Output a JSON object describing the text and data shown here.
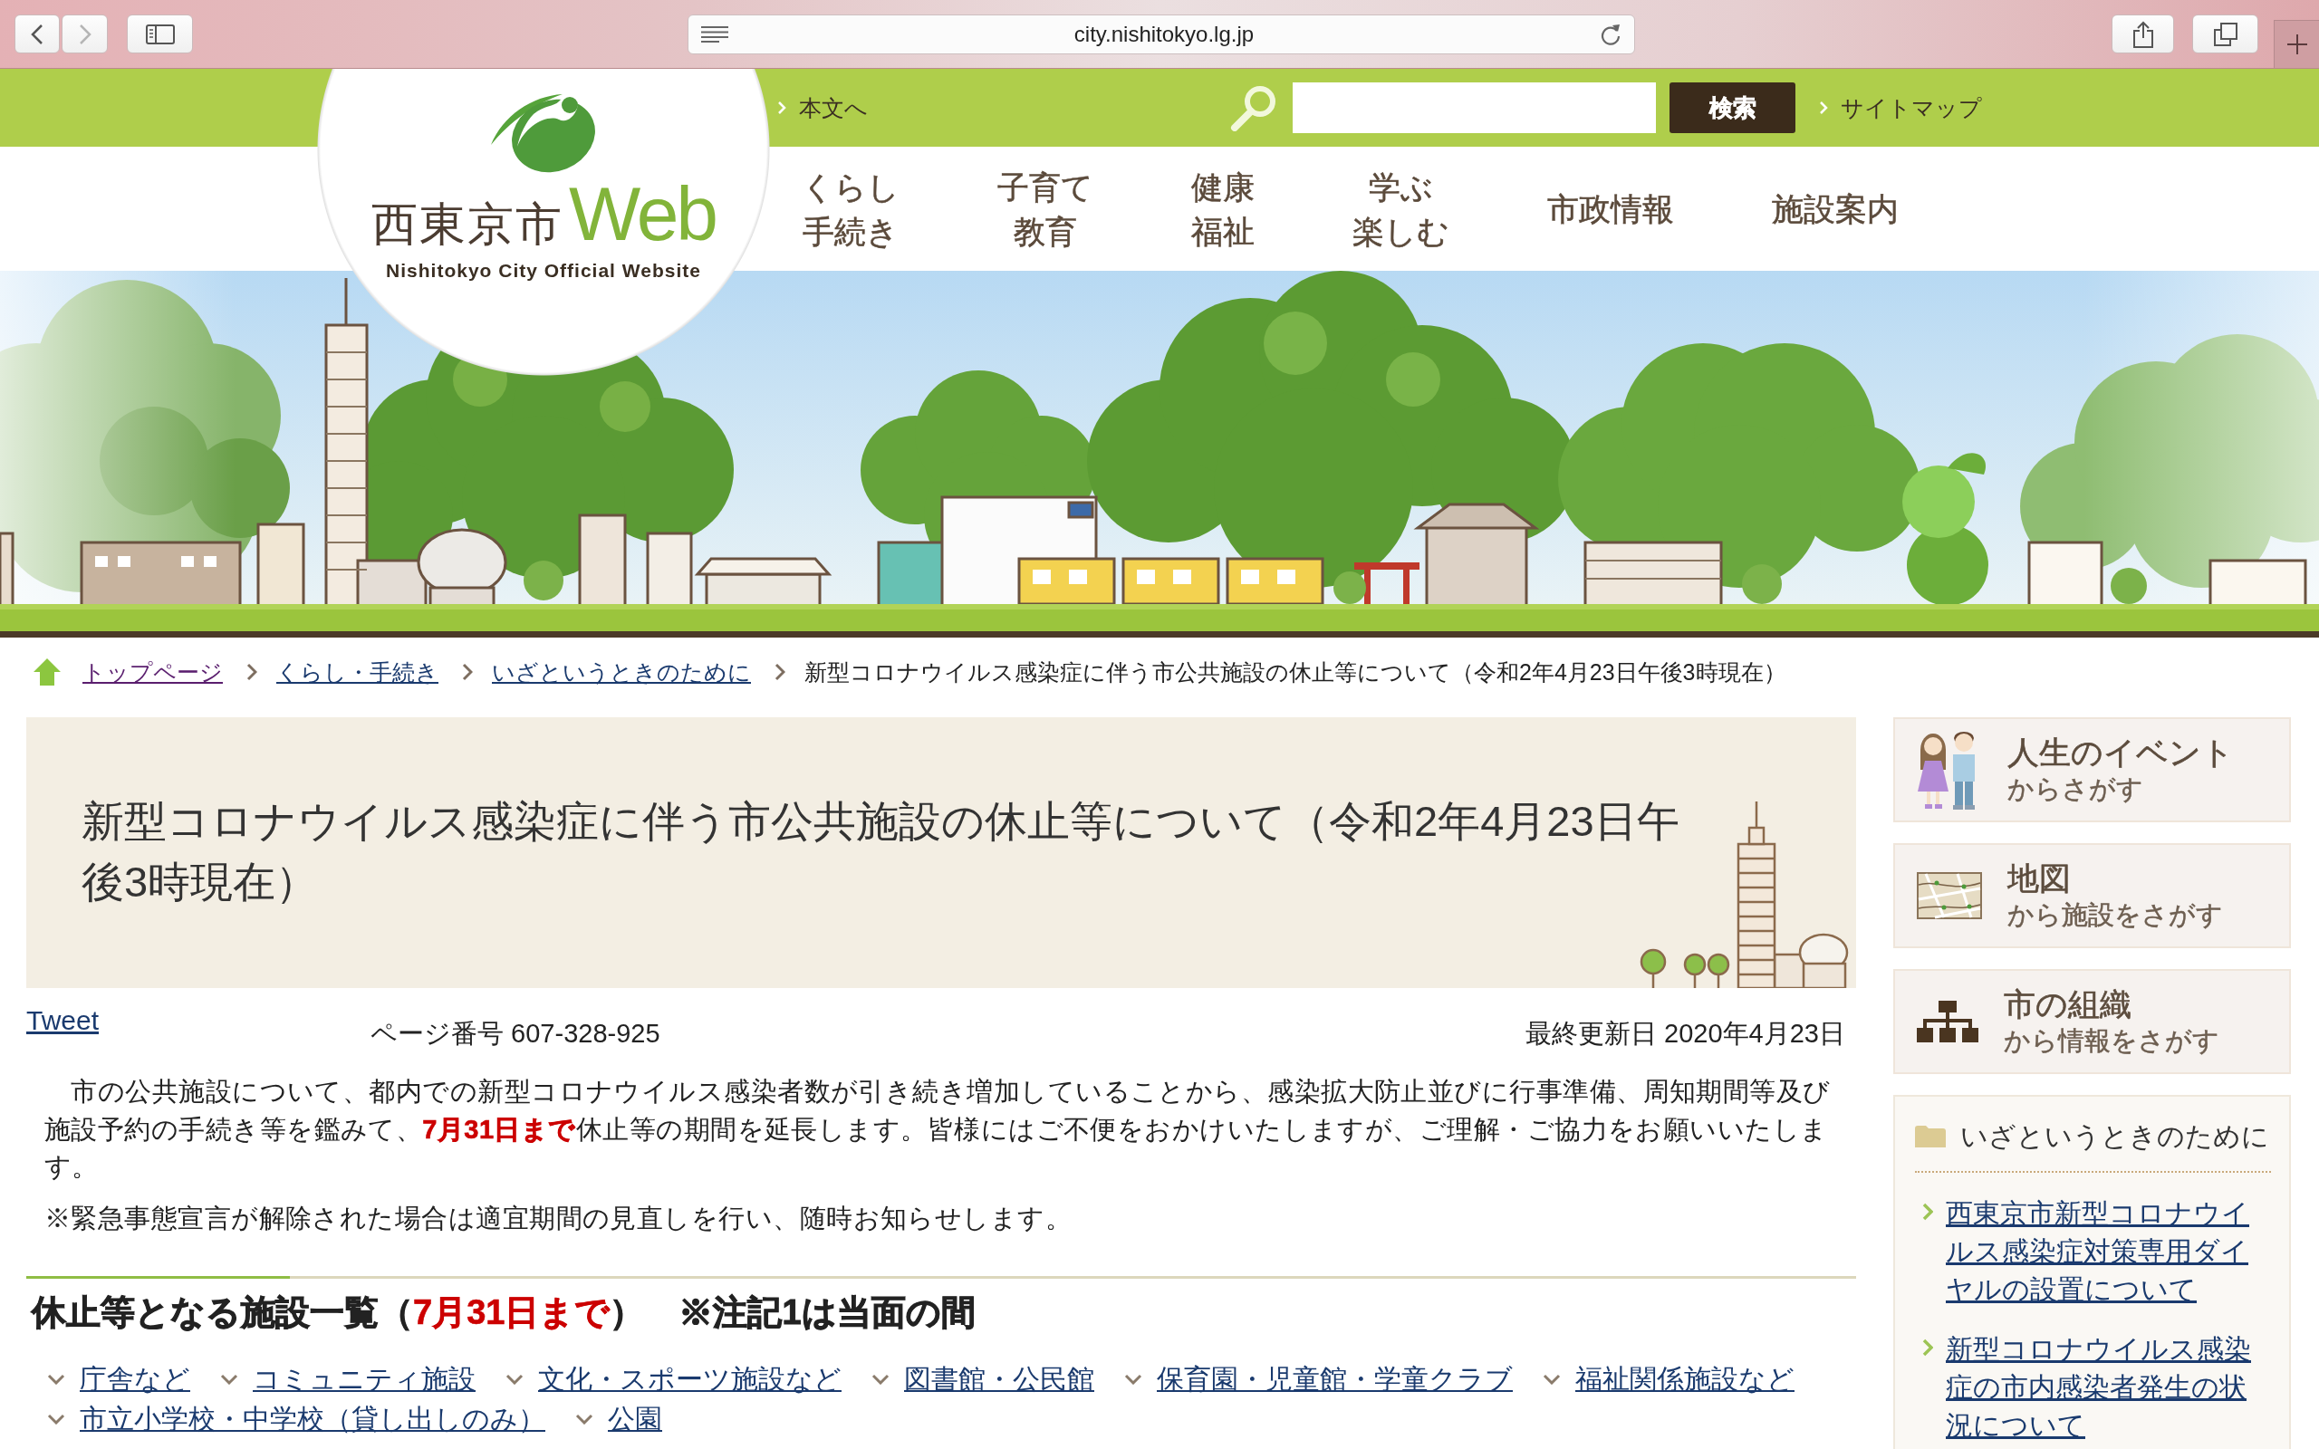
{
  "browser": {
    "url": "city.nishitokyo.lg.jp",
    "can_go_forward": false
  },
  "header": {
    "logo": {
      "wordmark": [
        {
          "text": "西東京市",
          "accent": false
        },
        {
          "text": "Web",
          "accent": true
        }
      ],
      "tagline": "Nishitokyo City Official Website"
    },
    "skip_link": "本文へ",
    "search": {
      "button": "検索"
    },
    "sitemap_link": "サイトマップ"
  },
  "nav": [
    {
      "lines": [
        "くらし",
        "手続き"
      ]
    },
    {
      "lines": [
        "子育て",
        "教育"
      ]
    },
    {
      "lines": [
        "健康",
        "福祉"
      ]
    },
    {
      "lines": [
        "学ぶ",
        "楽しむ"
      ]
    },
    {
      "lines": [
        "市政情報"
      ]
    },
    {
      "lines": [
        "施設案内"
      ]
    }
  ],
  "breadcrumb": {
    "links": [
      {
        "label": "トップページ",
        "visited": true
      },
      {
        "label": "くらし・手続き",
        "visited": false
      },
      {
        "label": "いざというときのために",
        "visited": false
      }
    ],
    "current": "新型コロナウイルス感染症に伴う市公共施設の休止等について（令和2年4月23日午後3時現在）"
  },
  "article": {
    "title": "新型コロナウイルス感染症に伴う市公共施設の休止等について（令和2年4月23日午後3時現在）",
    "tweet": "Tweet",
    "page_number": "ページ番号 607-328-925",
    "updated": "最終更新日 2020年4月23日",
    "paragraphs": [
      {
        "parts": [
          {
            "text": "　市の公共施設について、都内での新型コロナウイルス感染者数が引き続き増加していることから、感染拡大防止並びに行事準備、周知期間等及び施設予約の手続き等を鑑みて、",
            "emphasis": false
          },
          {
            "text": "7月31日まで",
            "emphasis": true
          },
          {
            "text": "休止等の期間を延長します。皆様にはご不便をおかけいたしますが、ご理解・ご協力をお願いいたします。",
            "emphasis": false
          }
        ]
      },
      {
        "parts": [
          {
            "text": "※緊急事態宣言が解除された場合は適宜期間の見直しを行い、随時お知らせします。",
            "emphasis": false
          }
        ]
      }
    ],
    "section_heading": {
      "parts": [
        {
          "text": "休止等となる施設一覧（",
          "emphasis": false
        },
        {
          "text": "7月31日まで",
          "emphasis": true
        },
        {
          "text": "）　※注記1は当面の間",
          "emphasis": false
        }
      ]
    },
    "facility_links": [
      "庁舎など",
      "コミュニティ施設",
      "文化・スポーツ施設など",
      "図書館・公民館",
      "保育園・児童館・学童クラブ",
      "福祉関係施設など",
      "市立小学校・中学校（貸し出しのみ）",
      "公園"
    ]
  },
  "sidebar": {
    "cards": [
      {
        "kind": "life_event",
        "title": "人生のイベント",
        "subtitle": "からさがす"
      },
      {
        "kind": "map",
        "title": "地図",
        "subtitle": "から施設をさがす"
      },
      {
        "kind": "organization",
        "title": "市の組織",
        "subtitle": "から情報をさがす"
      }
    ],
    "panel": {
      "heading": "いざというときのために",
      "links": [
        "西東京市新型コロナウイルス感染症対策専用ダイヤルの設置について",
        "新型コロナウイルス感染症の市内感染者発生の状況について"
      ]
    }
  }
}
